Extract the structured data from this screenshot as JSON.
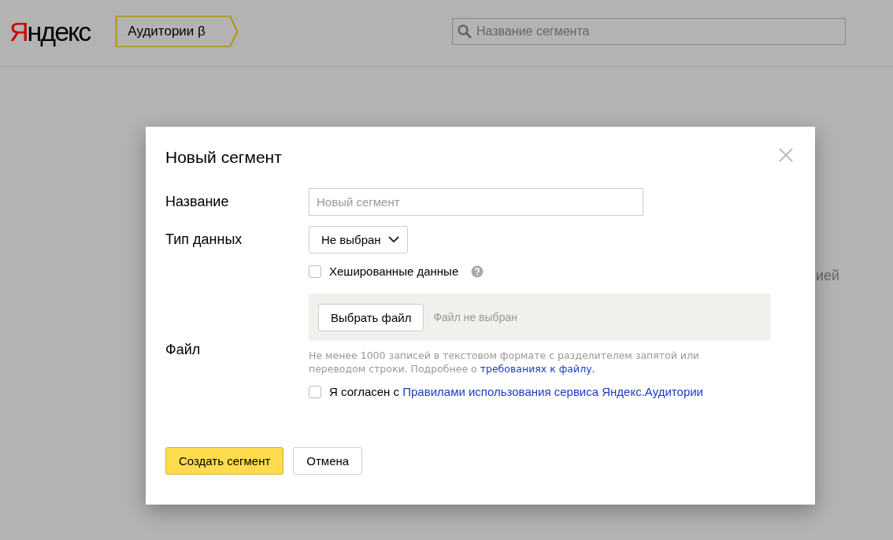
{
  "header": {
    "logo": {
      "accent": "Я",
      "rest": "ндекс"
    },
    "service_tab": "Аудитории β",
    "search": {
      "placeholder": "Название сегмента"
    }
  },
  "background_fragment": "ией",
  "dialog": {
    "title": "Новый сегмент",
    "name_field": {
      "label": "Название",
      "placeholder": "Новый сегмент"
    },
    "data_type": {
      "label": "Тип данных",
      "value": "Не выбран"
    },
    "hashed": {
      "label": "Хешированные данные",
      "checked": false
    },
    "file": {
      "label": "Файл",
      "button": "Выбрать файл",
      "status": "Файл не выбран",
      "hint": "Не менее 1000 записей в текстовом формате с разделителем запятой или переводом строки. Подробнее о ",
      "hint_link": "требованиях к файлу."
    },
    "agreement": {
      "text": "Я согласен с ",
      "link": "Правилами использования сервиса Яндекс.Аудитории",
      "checked": false
    },
    "buttons": [
      {
        "label": "Создать сегмент",
        "kind": "primary"
      },
      {
        "label": "Отмена",
        "kind": "secondary"
      }
    ]
  }
}
